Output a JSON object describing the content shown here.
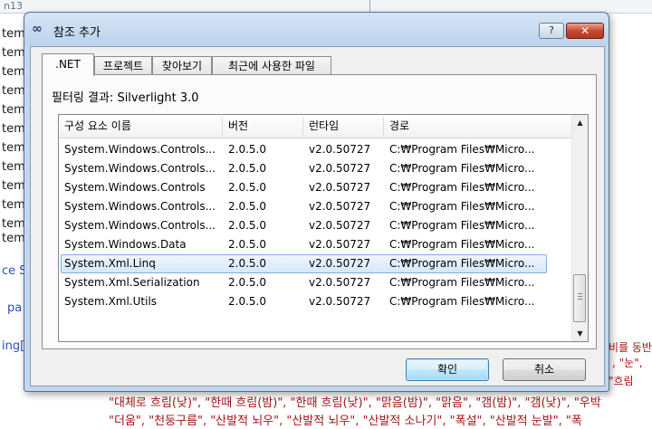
{
  "background": {
    "top_left_text": "n13",
    "top_right_text": "",
    "left_lines": [
      "tem",
      "tem",
      "tem",
      "tem",
      "tem",
      "tem",
      "tem",
      "tem",
      "tem",
      "tem",
      "tem",
      "tem"
    ],
    "line_ce": "ce S",
    "line_pa": "pa",
    "line_ing": "ing[",
    "right_lines": [
      "비를 동반",
      ", \"눈\",",
      "\"흐림",
      "\"우박"
    ],
    "bottom_lines": [
      "\"대체로 흐림(낮)\", \"한때 흐림(밤)\", \"한때 흐림(낮)\", \"맑음(밤)\", \"맑음\", \"갬(밤)\", \"갬(낮)\", \"우박",
      "\"더움\", \"천둥구름\", \"산발적 뇌우\", \"산발적 뇌우\", \"산발적 소나기\", \"폭설\", \"산발적 눈발\", \"폭"
    ]
  },
  "dialog": {
    "title": "참조 추가",
    "title_icon": "∞",
    "help_label": "?",
    "close_label": "✕",
    "tabs": [
      ".NET",
      "프로젝트",
      "찾아보기",
      "최근에 사용한 파일"
    ],
    "active_tab": 0,
    "filter_text": "필터링 결과: Silverlight 3.0",
    "columns": [
      "구성 요소 이름",
      "버전",
      "런타임",
      "경로"
    ],
    "rows": [
      [
        "System.Windows.Controls...",
        "2.0.5.0",
        "v2.0.50727",
        "C:₩Program Files₩Micro..."
      ],
      [
        "System.Windows.Controls...",
        "2.0.5.0",
        "v2.0.50727",
        "C:₩Program Files₩Micro..."
      ],
      [
        "System.Windows.Controls",
        "2.0.5.0",
        "v2.0.50727",
        "C:₩Program Files₩Micro..."
      ],
      [
        "System.Windows.Controls...",
        "2.0.5.0",
        "v2.0.50727",
        "C:₩Program Files₩Micro..."
      ],
      [
        "System.Windows.Controls...",
        "2.0.5.0",
        "v2.0.50727",
        "C:₩Program Files₩Micro..."
      ],
      [
        "System.Windows.Data",
        "2.0.5.0",
        "v2.0.50727",
        "C:₩Program Files₩Micro..."
      ],
      [
        "System.Xml.Linq",
        "2.0.5.0",
        "v2.0.50727",
        "C:₩Program Files₩Micro..."
      ],
      [
        "System.Xml.Serialization",
        "2.0.5.0",
        "v2.0.50727",
        "C:₩Program Files₩Micro..."
      ],
      [
        "System.Xml.Utils",
        "2.0.5.0",
        "v2.0.50727",
        "C:₩Program Files₩Micro..."
      ]
    ],
    "selected_row": 6,
    "ok_label": "확인",
    "cancel_label": "취소",
    "scroll_up": "▲",
    "scroll_down": "▼"
  }
}
